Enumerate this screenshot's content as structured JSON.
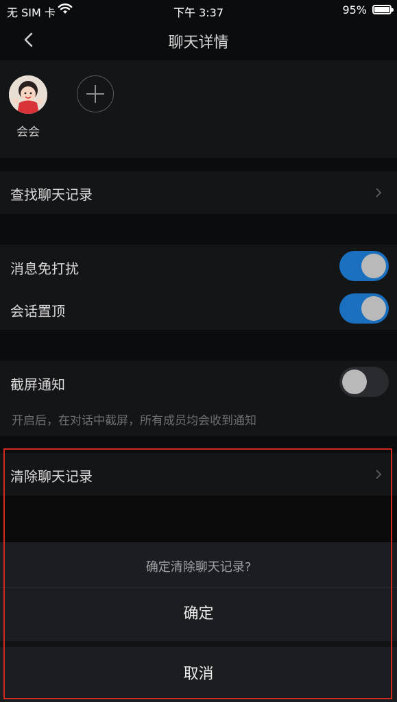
{
  "status_bar": {
    "carrier": "无 SIM 卡",
    "time": "下午 3:37",
    "battery_pct": "95%",
    "battery_level": 0.95
  },
  "nav": {
    "title": "聊天详情"
  },
  "members": [
    {
      "name": "会会"
    }
  ],
  "rows": {
    "search_history": "查找聊天记录",
    "do_not_disturb": {
      "label": "消息免打扰",
      "on": true
    },
    "pin_chat": {
      "label": "会话置顶",
      "on": true
    },
    "screenshot_notify": {
      "label": "截屏通知",
      "on": false,
      "hint": "开启后，在对话中截屏，所有成员均会收到通知"
    },
    "clear_history": "清除聊天记录"
  },
  "action_sheet": {
    "message": "确定清除聊天记录?",
    "confirm": "确定",
    "cancel": "取消"
  },
  "colors": {
    "accent": "#1a6fbf",
    "highlight": "#d22a21"
  }
}
